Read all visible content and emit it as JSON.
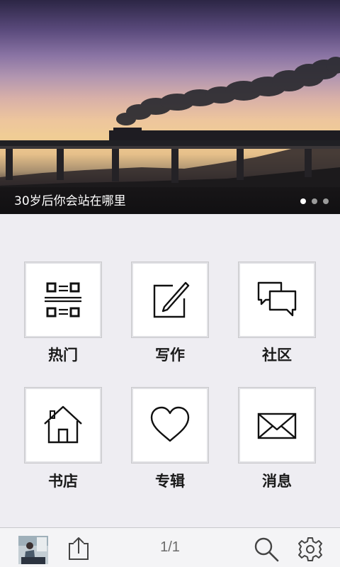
{
  "banner": {
    "caption": "30岁后你会站在哪里",
    "dots": [
      {
        "active": true
      },
      {
        "active": false
      },
      {
        "active": false
      }
    ]
  },
  "grid": [
    {
      "label": "热门",
      "icon": "qr-code-icon"
    },
    {
      "label": "写作",
      "icon": "edit-icon"
    },
    {
      "label": "社区",
      "icon": "chat-bubbles-icon"
    },
    {
      "label": "书店",
      "icon": "home-icon"
    },
    {
      "label": "专辑",
      "icon": "heart-icon"
    },
    {
      "label": "消息",
      "icon": "mail-icon"
    }
  ],
  "bottom_bar": {
    "page_indicator": "1/1",
    "icons": [
      "avatar",
      "share-icon",
      "search-icon",
      "settings-icon"
    ]
  },
  "colors": {
    "background": "#eeedf2",
    "tile_border": "#c9c9cc",
    "label_text": "#1a1a1a"
  }
}
